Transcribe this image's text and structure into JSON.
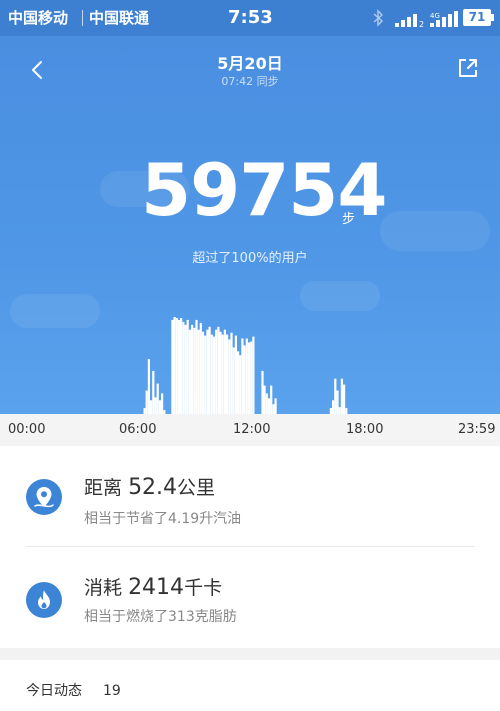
{
  "status_bar": {
    "carrier_1": "中国移动",
    "carrier_2": "中国联通",
    "time": "7:53",
    "signal_1_label": "2",
    "signal_2_label": "4G",
    "battery": "71"
  },
  "header": {
    "date": "5月20日",
    "sync_text": "07:42 同步"
  },
  "steps": {
    "value": "59754",
    "unit": "步",
    "comparison": "超过了100%的用户"
  },
  "time_axis": {
    "ticks": [
      "00:00",
      "06:00",
      "12:00",
      "18:00",
      "23:59"
    ]
  },
  "chart_data": {
    "type": "bar",
    "note_unit": "relative bar height (0-1), minute-of-day positions",
    "x_start_minute": 0,
    "x_end_minute": 1439,
    "bars": [
      [
        382,
        0.06
      ],
      [
        389,
        0.24
      ],
      [
        396,
        0.56
      ],
      [
        403,
        0.14
      ],
      [
        410,
        0.44
      ],
      [
        417,
        0.17
      ],
      [
        424,
        0.31
      ],
      [
        431,
        0.14
      ],
      [
        438,
        0.21
      ],
      [
        445,
        0.04
      ],
      [
        471,
        0.96
      ],
      [
        478,
        0.99
      ],
      [
        485,
        0.98
      ],
      [
        492,
        0.96
      ],
      [
        499,
        0.98
      ],
      [
        506,
        0.94
      ],
      [
        513,
        0.91
      ],
      [
        520,
        0.96
      ],
      [
        527,
        0.86
      ],
      [
        534,
        0.91
      ],
      [
        541,
        0.88
      ],
      [
        548,
        0.96
      ],
      [
        555,
        0.86
      ],
      [
        562,
        0.93
      ],
      [
        569,
        0.84
      ],
      [
        576,
        0.8
      ],
      [
        583,
        0.86
      ],
      [
        590,
        0.89
      ],
      [
        597,
        0.81
      ],
      [
        604,
        0.79
      ],
      [
        611,
        0.86
      ],
      [
        618,
        0.89
      ],
      [
        625,
        0.84
      ],
      [
        632,
        0.81
      ],
      [
        639,
        0.86
      ],
      [
        646,
        0.81
      ],
      [
        653,
        0.76
      ],
      [
        660,
        0.83
      ],
      [
        667,
        0.68
      ],
      [
        674,
        0.8
      ],
      [
        681,
        0.64
      ],
      [
        688,
        0.6
      ],
      [
        695,
        0.77
      ],
      [
        702,
        0.7
      ],
      [
        709,
        0.77
      ],
      [
        716,
        0.73
      ],
      [
        723,
        0.74
      ],
      [
        730,
        0.79
      ],
      [
        759,
        0.44
      ],
      [
        766,
        0.29
      ],
      [
        773,
        0.21
      ],
      [
        780,
        0.16
      ],
      [
        787,
        0.29
      ],
      [
        794,
        0.1
      ],
      [
        801,
        0.16
      ],
      [
        978,
        0.06
      ],
      [
        985,
        0.14
      ],
      [
        992,
        0.36
      ],
      [
        999,
        0.24
      ],
      [
        1006,
        0.07
      ],
      [
        1013,
        0.36
      ],
      [
        1020,
        0.3
      ],
      [
        1027,
        0.06
      ]
    ]
  },
  "stats": {
    "distance": {
      "label": "距离",
      "value": "52.4",
      "unit": "公里",
      "sub": "相当于节省了4.19升汽油"
    },
    "calories": {
      "label": "消耗",
      "value": "2414",
      "unit": "千卡",
      "sub": "相当于燃烧了313克脂肪"
    }
  },
  "today": {
    "label": "今日动态",
    "count": "19"
  },
  "colors": {
    "status_bar": "#3d7fd0",
    "hero_top": "#4a8ee0",
    "hero_bottom": "#5aa2ec",
    "icon_bg": "#3c84d6",
    "bar": "#ffffff"
  },
  "icons": {
    "back": "chevron-left-icon",
    "share": "share-icon",
    "distance": "location-pin-icon",
    "calories": "flame-icon",
    "bluetooth": "bluetooth-icon"
  }
}
